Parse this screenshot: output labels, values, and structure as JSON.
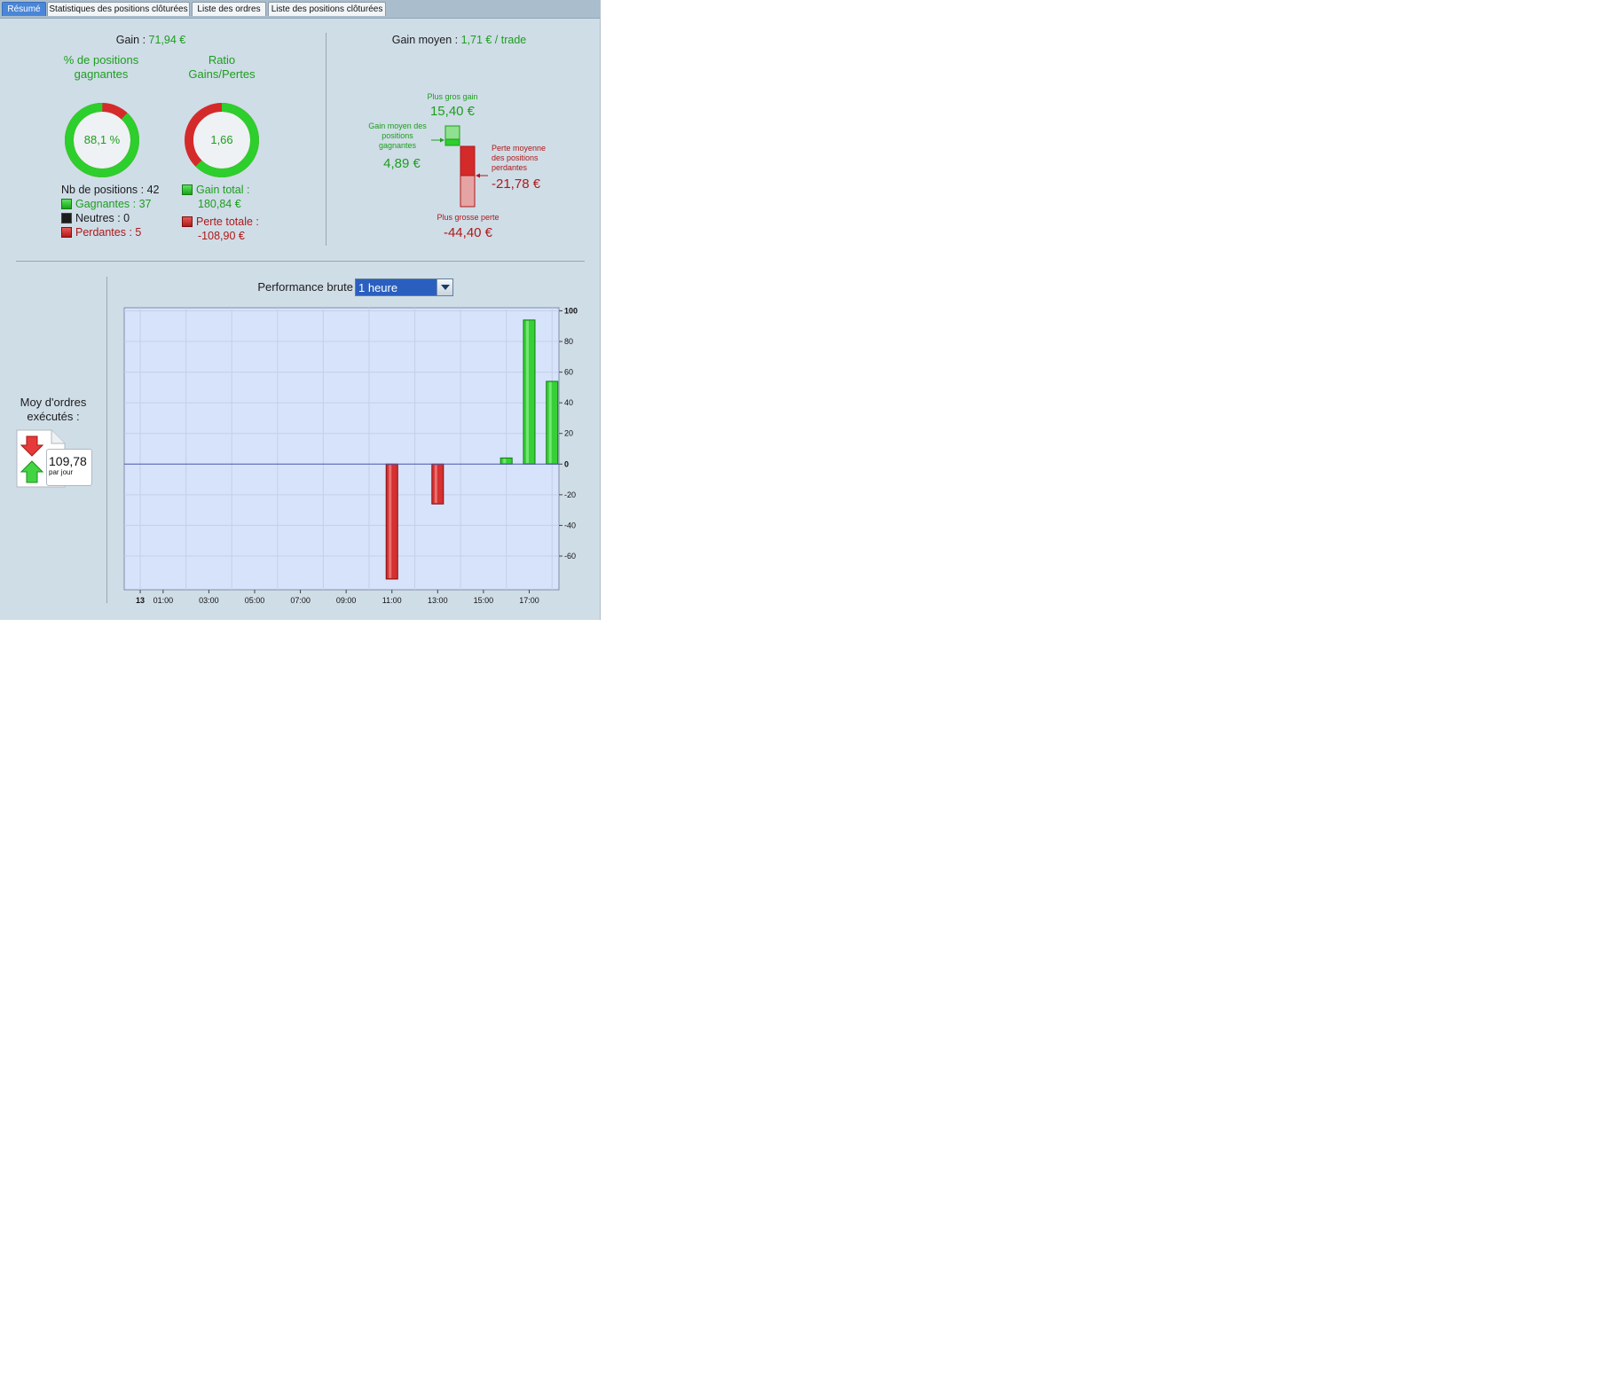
{
  "tabs": [
    {
      "label": "Résumé",
      "active": true
    },
    {
      "label": "Statistiques des positions clôturées",
      "active": false
    },
    {
      "label": "Liste des ordres",
      "active": false
    },
    {
      "label": "Liste des positions clôturées",
      "active": false
    }
  ],
  "summary": {
    "gain_label": "Gain : ",
    "gain_value": "71,94 €",
    "winning_pct_title": "% de positions gagnantes",
    "winning_pct_value": "88,1 %",
    "winning_pct_fraction": 0.881,
    "ratio_title": "Ratio Gains/Pertes",
    "ratio_value": "1,66",
    "ratio_fraction": 0.624,
    "positions_label": "Nb de positions : 42",
    "winners_label": "Gagnantes : 37",
    "neutrals_label": "Neutres : 0",
    "losers_label": "Perdantes : 5",
    "total_gain_label": "Gain total :",
    "total_gain_value": "180,84 €",
    "total_loss_label": "Perte totale :",
    "total_loss_value": "-108,90 €"
  },
  "average": {
    "gain_moyen_label": "Gain moyen : ",
    "gain_moyen_value": "1,71 € / trade",
    "best_gain_label": "Plus gros gain",
    "best_gain_value": "15,40 €",
    "avg_win_label": "Gain moyen des positions gagnantes",
    "avg_win_value": "4,89 €",
    "avg_loss_label": "Perte moyenne des positions perdantes",
    "avg_loss_value": "-21,78 €",
    "worst_loss_label": "Plus grosse perte",
    "worst_loss_value": "-44,40 €"
  },
  "orders": {
    "title": "Moy d'ordres exécutés :",
    "value": "109,78",
    "unit": "par jour"
  },
  "performance": {
    "label": "Performance brute",
    "period": "1 heure"
  },
  "colors": {
    "positive": "#1d9e1d",
    "negative": "#b01818",
    "plot_bg": "#d7e3fb",
    "panel_bg": "#cfdde7"
  },
  "chart_data": {
    "type": "bar",
    "xlabel": "",
    "ylabel": "",
    "ylim": [
      -82,
      102
    ],
    "grid": true,
    "x_ticks": [
      "13",
      "01:00",
      "03:00",
      "05:00",
      "07:00",
      "09:00",
      "11:00",
      "13:00",
      "15:00",
      "17:00"
    ],
    "y_ticks": [
      100,
      80,
      60,
      40,
      20,
      0,
      -20,
      -40,
      -60
    ],
    "x_axis_unit": "hour",
    "x_range_hours": [
      -0.7,
      18.3
    ],
    "bars": [
      {
        "hour": 11,
        "value": -75
      },
      {
        "hour": 13,
        "value": -26
      },
      {
        "hour": 16,
        "value": 4
      },
      {
        "hour": 17,
        "value": 94
      },
      {
        "hour": 18,
        "value": 54
      }
    ]
  }
}
